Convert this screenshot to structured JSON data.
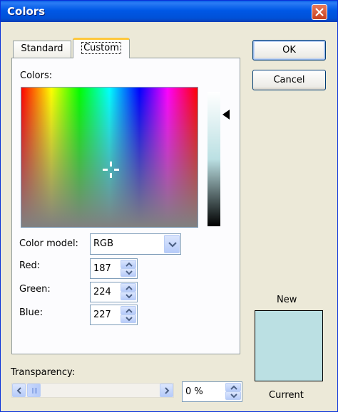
{
  "window": {
    "title": "Colors"
  },
  "tabs": [
    {
      "label": "Standard"
    },
    {
      "label": "Custom"
    }
  ],
  "buttons": {
    "ok": "OK",
    "cancel": "Cancel"
  },
  "custom": {
    "colors_label": "Colors:",
    "color_model": {
      "label": "Color model:",
      "value": "RGB"
    },
    "red": {
      "label": "Red:",
      "value": "187"
    },
    "green": {
      "label": "Green:",
      "value": "224"
    },
    "blue": {
      "label": "Blue:",
      "value": "227"
    }
  },
  "preview": {
    "new_label": "New",
    "current_label": "Current",
    "new_color": "#bbe0e3",
    "current_color": "#bbe0e3"
  },
  "transparency": {
    "label": "Transparency:",
    "value": "0 %"
  },
  "icons": [
    "close-icon",
    "crosshair-icon",
    "arrow-icon",
    "chevron-down-icon",
    "chevron-up-icon",
    "chevron-left-icon",
    "chevron-right-icon"
  ]
}
